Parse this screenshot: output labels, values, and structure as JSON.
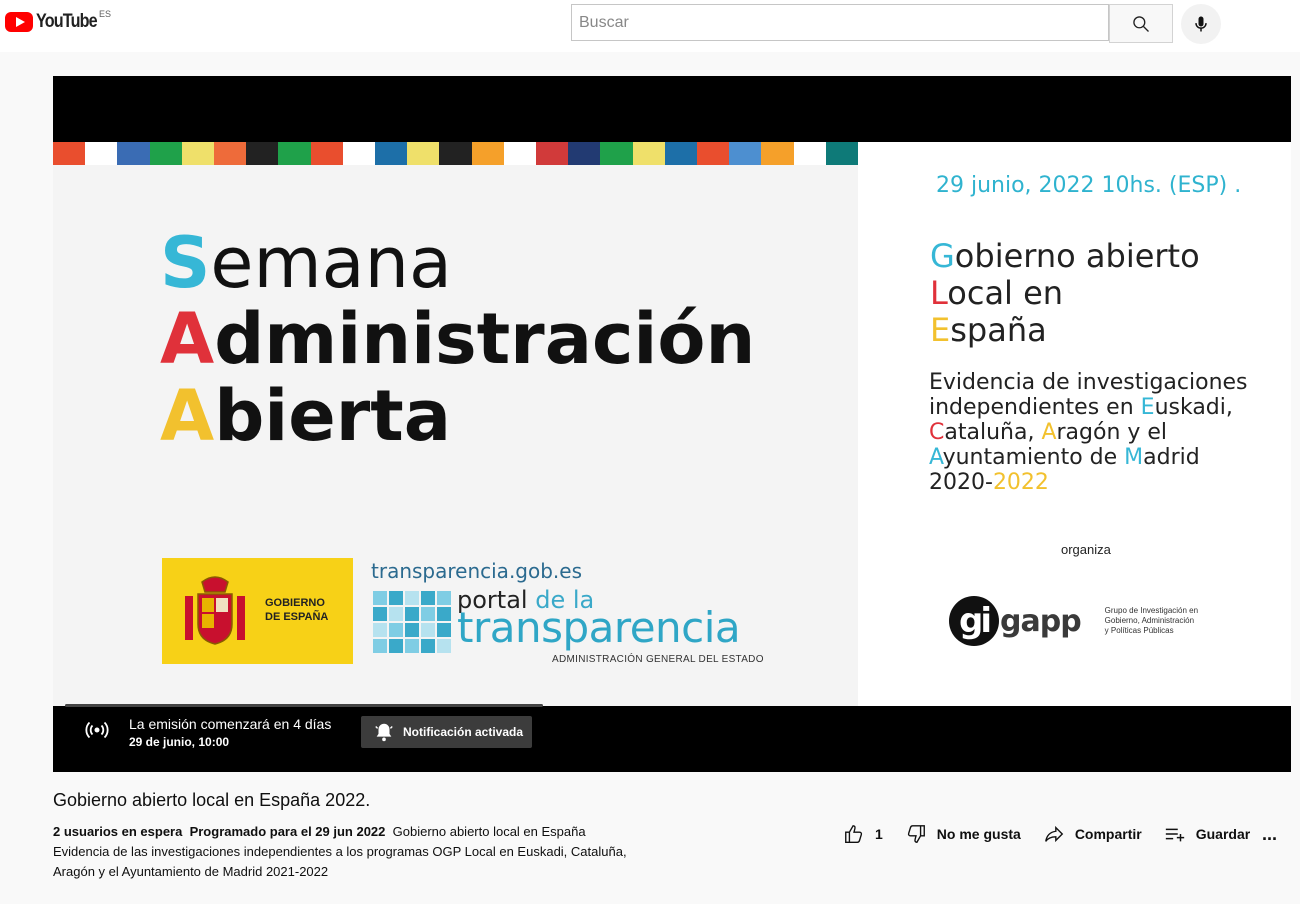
{
  "header": {
    "logo_text": "YouTube",
    "country_code": "ES",
    "search_placeholder": "Buscar"
  },
  "icons": {
    "search": "search-icon",
    "mic": "microphone-icon",
    "live": "live-broadcast-icon",
    "bell": "bell-icon",
    "like": "thumbs-up-icon",
    "dislike": "thumbs-down-icon",
    "share": "share-icon",
    "save": "playlist-add-icon",
    "more": "more-icon"
  },
  "slide": {
    "line1_first": "S",
    "line1_rest": "emana",
    "line2_first": "A",
    "line2_rest": "dministración",
    "line3_first": "A",
    "line3_rest": "bierta",
    "gob_line1": "GOBIERNO",
    "gob_line2": "DE ESPAÑA",
    "portal_url": "transparencia.gob.es",
    "portal_de": "portal ",
    "portal_de_la": "de la",
    "portal_word": "transparencia",
    "portal_agency": "ADMINISTRACIÓN GENERAL DEL ESTADO",
    "date": "29 junio, 2022 10hs.  (ESP) .",
    "gal_1a": "G",
    "gal_1b": "obierno abierto",
    "gal_2a": "L",
    "gal_2b": "ocal en",
    "gal_3a": "E",
    "gal_3b": "spaña",
    "ev_1": "Evidencia de investigaciones",
    "ev_2a": "independientes en ",
    "ev_2b": "E",
    "ev_2c": "uskadi,",
    "ev_3a": "C",
    "ev_3b": "ataluña, ",
    "ev_3c": "A",
    "ev_3d": "ragón y el",
    "ev_4a": "A",
    "ev_4b": "yuntamiento de ",
    "ev_4c": "M",
    "ev_4d": "adrid",
    "ev_5a": "2020-",
    "ev_5b": "2022",
    "organiza": "organiza",
    "gi": "gi",
    "gapp": "gapp",
    "gigapp_1": "Grupo de Investigación en",
    "gigapp_2": "Gobierno, Administración",
    "gigapp_3": "y Políticas Públicas",
    "colors": {
      "cyan": "#36b7d6",
      "red": "#e0313a",
      "yellow": "#f2c12e",
      "stripe": [
        "#e94e2e",
        "#ffffff",
        "#3a6cb4",
        "#1fa14a",
        "#efe06a",
        "#ee6b3a",
        "#222222",
        "#1fa14a",
        "#e94e2e",
        "#ffffff",
        "#1d6fa8",
        "#efe06a",
        "#222222",
        "#f5a02a",
        "#ffffff",
        "#d13a3a",
        "#223a72",
        "#1fa14a",
        "#efe06a",
        "#1d6fa8",
        "#e94e2e",
        "#4d8fd0",
        "#f5a02a",
        "#ffffff",
        "#0e7a78"
      ]
    }
  },
  "live": {
    "title": "La emisión comenzará en 4 días",
    "subtitle": "29 de junio, 10:00",
    "notif_label": "Notificación activada"
  },
  "video": {
    "title": "Gobierno abierto local en España 2022.",
    "waiting": "2 usuarios en espera",
    "scheduled": "Programado para el 29 jun 2022",
    "desc_1": "Gobierno abierto local en España",
    "desc_2": "Evidencia de las investigaciones independientes a los programas OGP Local en Euskadi, Cataluña,",
    "desc_3": "Aragón y el Ayuntamiento de Madrid 2021-2022"
  },
  "actions": {
    "like_count": "1",
    "dislike_label": "No me gusta",
    "share_label": "Compartir",
    "save_label": "Guardar",
    "more_label": "..."
  }
}
